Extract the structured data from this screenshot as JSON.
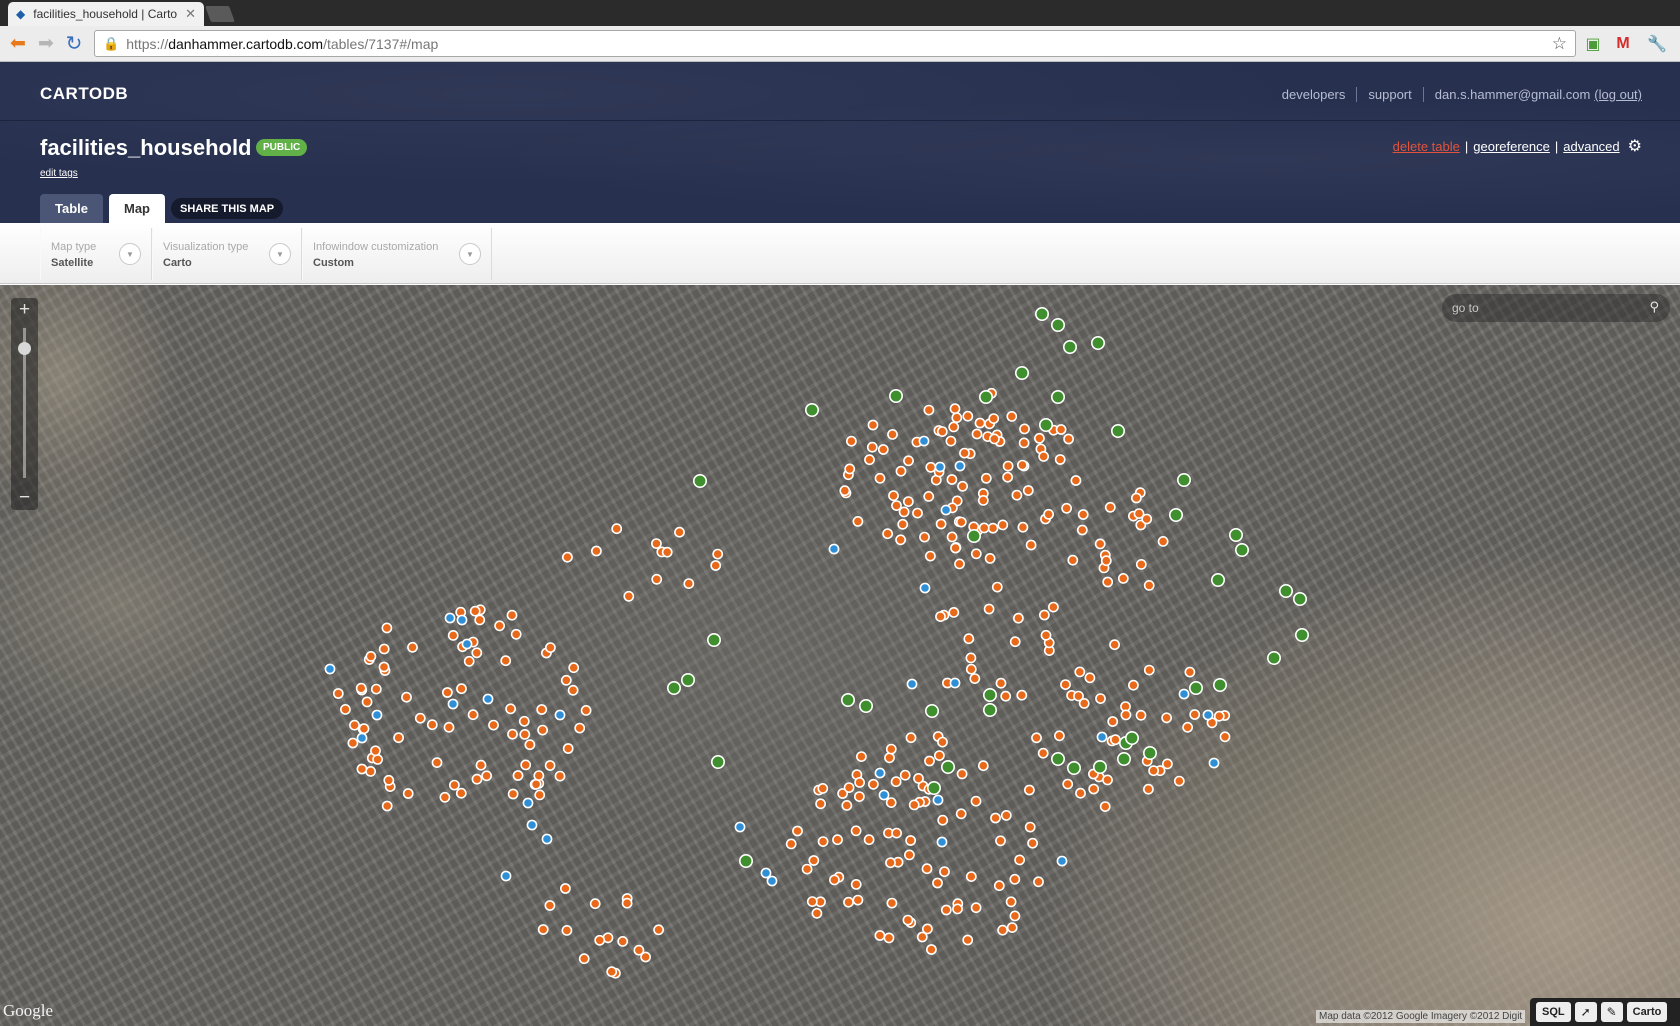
{
  "browser": {
    "tab_title": "facilities_household | Carto",
    "url_prefix": "https://",
    "url_host": "danhammer.cartodb.com",
    "url_path": "/tables/7137#/map"
  },
  "header": {
    "logo": "CARTODB",
    "links": {
      "developers": "developers",
      "support": "support",
      "email": "dan.s.hammer@gmail.com",
      "logout": "(log out)"
    },
    "table_name": "facilities_household",
    "badge": "PUBLIC",
    "edit_tags": "edit tags",
    "actions": {
      "delete": "delete table",
      "georeference": "georeference",
      "advanced": "advanced"
    },
    "tabs": {
      "table": "Table",
      "map": "Map",
      "share": "SHARE THIS MAP"
    }
  },
  "options": [
    {
      "label": "Map type",
      "value": "Satellite"
    },
    {
      "label": "Visualization type",
      "value": "Carto"
    },
    {
      "label": "Infowindow customization",
      "value": "Custom"
    }
  ],
  "map": {
    "goto_placeholder": "go to",
    "google": "Google",
    "attribution": "Map data ©2012 Google Imagery ©2012 Digit",
    "controls": {
      "sql": "SQL",
      "carto": "Carto"
    },
    "colors": {
      "orange": "#e8691a",
      "blue": "#2e8fd6",
      "green": "#3f8f2f"
    }
  }
}
